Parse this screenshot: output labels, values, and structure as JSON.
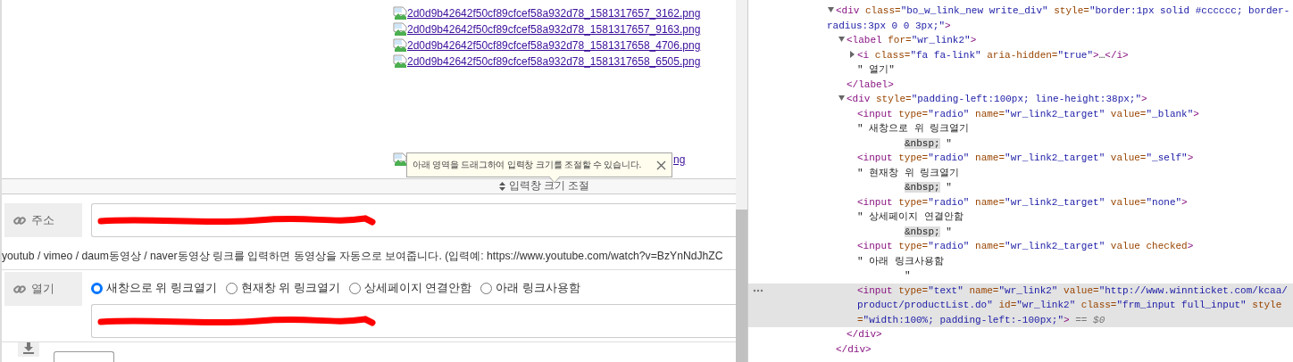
{
  "page": {
    "image_links": [
      {
        "text": "2d0d9b42642f50cf89cfcef58a932d78_1581317657_3162.png"
      },
      {
        "text": "2d0d9b42642f50cf89cfcef58a932d78_1581317657_9163.png"
      },
      {
        "text": "2d0d9b42642f50cf89cfcef58a932d78_1581317658_4706.png"
      },
      {
        "text": "2d0d9b42642f50cf89cfcef58a932d78_1581317658_6505.png"
      }
    ],
    "covered_image_link": {
      "text": "ng"
    },
    "tooltip": {
      "text": "아래 영역을 드래그하여 입력창 크기를 조절할 수 있습니다."
    },
    "resize_bar": {
      "label": "입력창 크기 조절"
    },
    "link_field": {
      "label": "주소",
      "redacted": true
    },
    "help_text": "youtub / vimeo / daum동영상 / naver동영상 링크를 입력하면 동영상을 자동으로 보여줍니다. (입력예: https://www.youtube.com/watch?v=BzYnNdJhZC",
    "target_field": {
      "label": "열기",
      "options": [
        {
          "label": "새창으로 위 링크열기",
          "selected": true
        },
        {
          "label": "현재창 위 링크열기",
          "selected": false
        },
        {
          "label": "상세페이지 연결안함",
          "selected": false
        },
        {
          "label": "아래 링크사용함",
          "selected": false
        }
      ],
      "link_input": {
        "redacted": true
      }
    }
  },
  "devtools": {
    "nodes": [
      {
        "lines": [
          [
            {
              "kind": "tag",
              "text": "<div"
            },
            {
              "kind": "attr",
              "text": " class="
            },
            {
              "kind": "val",
              "text": "\"bo_w_link_new write_div\""
            },
            {
              "kind": "attr",
              "text": " style="
            },
            {
              "kind": "val",
              "text": "\"border:1px solid #cccccc; border-radius:3px 0 0 3px;\""
            },
            {
              "kind": "tag",
              "text": ">"
            }
          ]
        ],
        "expanded": true,
        "selected": false,
        "closing": [
          {
            "kind": "tag",
            "text": "</div>"
          }
        ],
        "children": [
          {
            "lines": [
              [
                {
                  "kind": "tag",
                  "text": "<label"
                },
                {
                  "kind": "attr",
                  "text": " for="
                },
                {
                  "kind": "val",
                  "text": "\"wr_link2\""
                },
                {
                  "kind": "tag",
                  "text": ">"
                }
              ]
            ],
            "expanded": true,
            "selected": false,
            "closing": [
              {
                "kind": "tag",
                "text": "</label>"
              }
            ],
            "children": [
              {
                "lines": [
                  [
                    {
                      "kind": "tag",
                      "text": "<i"
                    },
                    {
                      "kind": "attr",
                      "text": " class="
                    },
                    {
                      "kind": "val",
                      "text": "\"fa fa-link\""
                    },
                    {
                      "kind": "attr",
                      "text": " aria-hidden="
                    },
                    {
                      "kind": "val",
                      "text": "\"true\""
                    },
                    {
                      "kind": "tag",
                      "text": ">"
                    },
                    {
                      "kind": "text",
                      "text": "…"
                    },
                    {
                      "kind": "tag",
                      "text": "</i>"
                    }
                  ]
                ],
                "expanded": false,
                "selected": false
              },
              {
                "lines": [
                  [
                    {
                      "kind": "text",
                      "text": "\" 열기\""
                    }
                  ]
                ],
                "selected": false
              }
            ]
          },
          {
            "lines": [
              [
                {
                  "kind": "tag",
                  "text": "<div"
                },
                {
                  "kind": "attr",
                  "text": " style="
                },
                {
                  "kind": "val",
                  "text": "\"padding-left:100px; line-height:38px;\""
                },
                {
                  "kind": "tag",
                  "text": ">"
                }
              ]
            ],
            "expanded": true,
            "selected": false,
            "closing": [
              {
                "kind": "tag",
                "text": "</div>"
              }
            ],
            "children": [
              {
                "lines": [
                  [
                    {
                      "kind": "tag",
                      "text": "<input"
                    },
                    {
                      "kind": "attr",
                      "text": " type="
                    },
                    {
                      "kind": "val",
                      "text": "\"radio\""
                    },
                    {
                      "kind": "attr",
                      "text": " name="
                    },
                    {
                      "kind": "val",
                      "text": "\"wr_link2_target\""
                    },
                    {
                      "kind": "attr",
                      "text": " value="
                    },
                    {
                      "kind": "val",
                      "text": "\"_blank\""
                    },
                    {
                      "kind": "tag",
                      "text": ">"
                    }
                  ]
                ],
                "selected": false
              },
              {
                "lines": [
                  [
                    {
                      "kind": "text",
                      "text": "\" 새창으로 위 링크열기"
                    }
                  ],
                  [
                    {
                      "kind": "nbsp",
                      "text": "&nbsp;"
                    },
                    {
                      "kind": "text",
                      "text": " \""
                    }
                  ]
                ],
                "selected": false
              },
              {
                "lines": [
                  [
                    {
                      "kind": "tag",
                      "text": "<input"
                    },
                    {
                      "kind": "attr",
                      "text": " type="
                    },
                    {
                      "kind": "val",
                      "text": "\"radio\""
                    },
                    {
                      "kind": "attr",
                      "text": " name="
                    },
                    {
                      "kind": "val",
                      "text": "\"wr_link2_target\""
                    },
                    {
                      "kind": "attr",
                      "text": " value="
                    },
                    {
                      "kind": "val",
                      "text": "\"_self\""
                    },
                    {
                      "kind": "tag",
                      "text": ">"
                    }
                  ]
                ],
                "selected": false
              },
              {
                "lines": [
                  [
                    {
                      "kind": "text",
                      "text": "\" 현재창 위 링크열기"
                    }
                  ],
                  [
                    {
                      "kind": "nbsp",
                      "text": "&nbsp;"
                    },
                    {
                      "kind": "text",
                      "text": " \""
                    }
                  ]
                ],
                "selected": false
              },
              {
                "lines": [
                  [
                    {
                      "kind": "tag",
                      "text": "<input"
                    },
                    {
                      "kind": "attr",
                      "text": " type="
                    },
                    {
                      "kind": "val",
                      "text": "\"radio\""
                    },
                    {
                      "kind": "attr",
                      "text": " name="
                    },
                    {
                      "kind": "val",
                      "text": "\"wr_link2_target\""
                    },
                    {
                      "kind": "attr",
                      "text": " value="
                    },
                    {
                      "kind": "val",
                      "text": "\"none\""
                    },
                    {
                      "kind": "tag",
                      "text": ">"
                    }
                  ]
                ],
                "selected": false
              },
              {
                "lines": [
                  [
                    {
                      "kind": "text",
                      "text": "\" 상세페이지 연결안함"
                    }
                  ],
                  [
                    {
                      "kind": "nbsp",
                      "text": "&nbsp;"
                    },
                    {
                      "kind": "text",
                      "text": " \""
                    }
                  ]
                ],
                "selected": false
              },
              {
                "lines": [
                  [
                    {
                      "kind": "tag",
                      "text": "<input"
                    },
                    {
                      "kind": "attr",
                      "text": " type="
                    },
                    {
                      "kind": "val",
                      "text": "\"radio\""
                    },
                    {
                      "kind": "attr",
                      "text": " name="
                    },
                    {
                      "kind": "val",
                      "text": "\"wr_link2_target\""
                    },
                    {
                      "kind": "attr",
                      "text": " value checked"
                    },
                    {
                      "kind": "tag",
                      "text": ">"
                    }
                  ]
                ],
                "selected": false
              },
              {
                "lines": [
                  [
                    {
                      "kind": "text",
                      "text": "\" 아래 링크사용함"
                    }
                  ],
                  [
                    {
                      "kind": "text",
                      "text": "\""
                    }
                  ]
                ],
                "selected": false
              },
              {
                "lines": [
                  [
                    {
                      "kind": "tag",
                      "text": "<input"
                    },
                    {
                      "kind": "attr",
                      "text": " type="
                    },
                    {
                      "kind": "val",
                      "text": "\"text\""
                    },
                    {
                      "kind": "attr",
                      "text": " name="
                    },
                    {
                      "kind": "val",
                      "text": "\"wr_link2\""
                    },
                    {
                      "kind": "attr",
                      "text": " value="
                    },
                    {
                      "kind": "val",
                      "text": "\"http://www.winnticket.com/kcaa/product/productList.do\""
                    },
                    {
                      "kind": "attr",
                      "text": " id="
                    },
                    {
                      "kind": "val",
                      "text": "\"wr_link2\""
                    },
                    {
                      "kind": "attr",
                      "text": " class="
                    },
                    {
                      "kind": "val",
                      "text": "\"frm_input full_input\""
                    },
                    {
                      "kind": "attr",
                      "text": " style="
                    },
                    {
                      "kind": "val",
                      "text": "\"width:100%; padding-left:-100px;\""
                    },
                    {
                      "kind": "tag",
                      "text": ">"
                    },
                    {
                      "kind": "ref",
                      "text": " == $0"
                    }
                  ]
                ],
                "selected": true
              }
            ]
          }
        ]
      }
    ]
  }
}
